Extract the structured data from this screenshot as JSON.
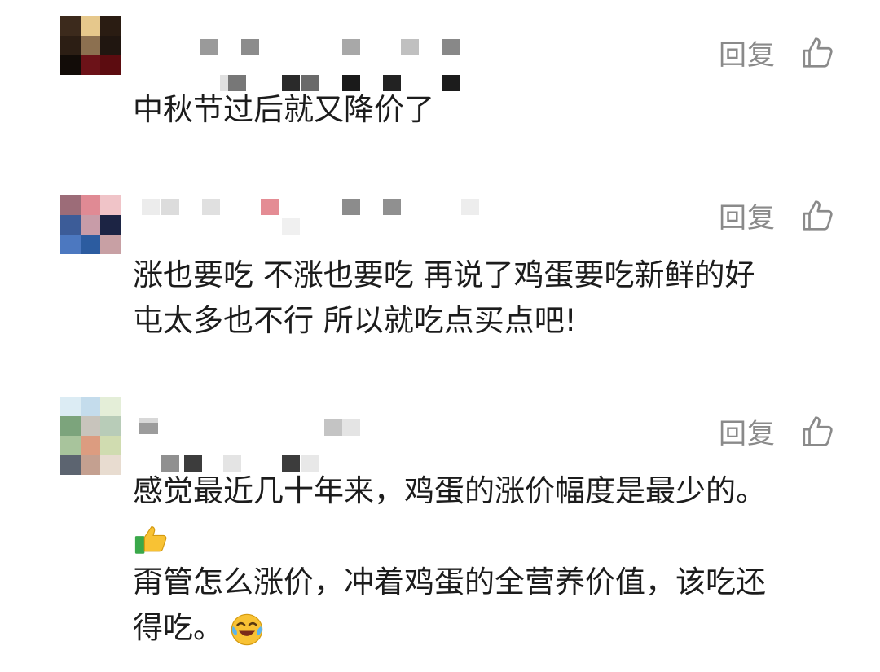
{
  "comments": [
    {
      "reply_label": "回复",
      "like_icon": "thumbs-up-outline-icon",
      "text_lines": [
        "中秋节过后就又降价了"
      ]
    },
    {
      "reply_label": "回复",
      "like_icon": "thumbs-up-outline-icon",
      "text_lines": [
        "涨也要吃 不涨也要吃 再说了鸡蛋要吃新鲜的好",
        "屯太多也不行 所以就吃点买点吧!"
      ]
    },
    {
      "reply_label": "回复",
      "like_icon": "thumbs-up-outline-icon",
      "text_lines": [
        "感觉最近几十年来，鸡蛋的涨价幅度是最少的。",
        "甭管怎么涨价，冲着鸡蛋的全营养价值，该吃还",
        "得吃。"
      ],
      "emojis": [
        "thumbs-up-emoji",
        "crying-laughing-emoji"
      ]
    }
  ],
  "colors": {
    "text": "#1c1c1c",
    "action": "#8a8a8a"
  }
}
